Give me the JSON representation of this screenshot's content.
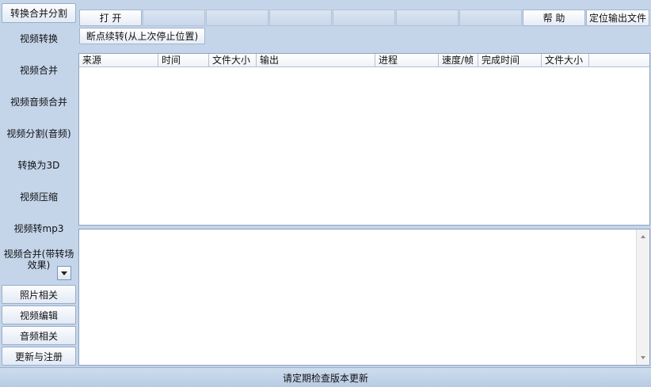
{
  "sidebar": {
    "top_button": "转换合并分割",
    "items": [
      "视频转换",
      "视频合并",
      "视频音频合并",
      "视频分割(音频)",
      "转换为3D",
      "视频压缩",
      "视频转mp3"
    ],
    "multi_item_line1": "视频合并(带转场",
    "multi_item_line2": "效果)",
    "bottom_buttons": [
      "照片相关",
      "视频编辑",
      "音频相关",
      "更新与注册"
    ]
  },
  "toolbar": {
    "open_label": "打 开",
    "help_label": "帮 助",
    "locate_output_label": "定位输出文件",
    "resume_label": "断点续转(从上次停止位置)"
  },
  "table": {
    "columns": [
      "来源",
      "时间",
      "文件大小",
      "输出",
      "进程",
      "速度/帧",
      "完成时间",
      "文件大小"
    ]
  },
  "status": {
    "message": "请定期检查版本更新"
  }
}
